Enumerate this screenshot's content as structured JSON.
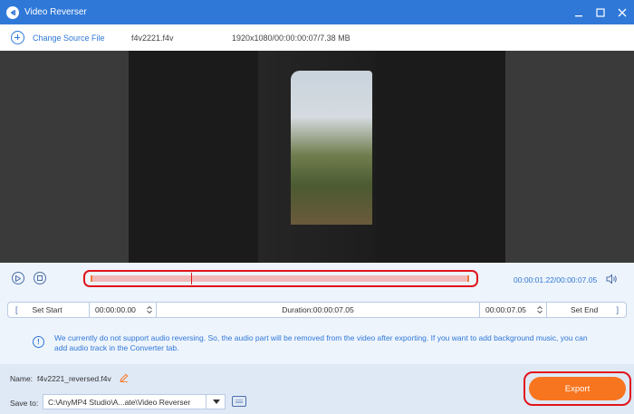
{
  "window": {
    "title": "Video Reverser"
  },
  "toolbar": {
    "change_source": "Change Source File",
    "file_name": "f4v2221.f4v",
    "file_info": "1920x1080/00:00:00:07/7.38 MB"
  },
  "player": {
    "current_time": "00:00:01.22",
    "total_time": "/00:00:07.05",
    "timeline_position": 0.26
  },
  "range": {
    "set_start": "Set Start",
    "start_value": "00:00:00.00",
    "duration": "Duration:00:00:07.05",
    "end_value": "00:00:07.05",
    "set_end": "Set End"
  },
  "notice": {
    "text": "We currently do not support audio reversing. So, the audio part will be removed from the video after exporting. If you want to add background music, you can add audio track in the Converter tab."
  },
  "output": {
    "name_label": "Name:",
    "name_value": "f4v2221_reversed.f4v",
    "save_label": "Save to:",
    "save_path": "C:\\AnyMP4 Studio\\A...ate\\Video Reverser",
    "export_label": "Export"
  },
  "colors": {
    "accent": "#2f78d8",
    "export": "#f8751f",
    "highlight": "#e0141b"
  }
}
